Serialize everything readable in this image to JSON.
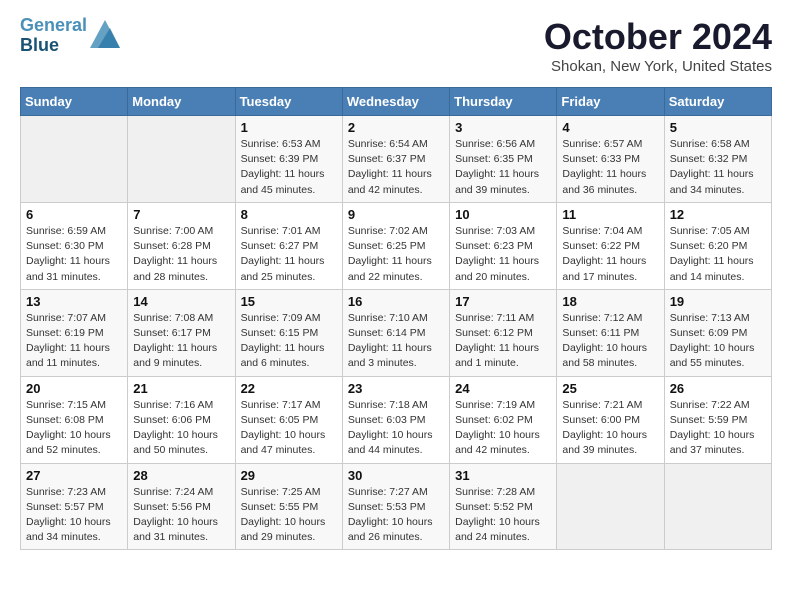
{
  "header": {
    "logo_line1": "General",
    "logo_line2": "Blue",
    "month": "October 2024",
    "location": "Shokan, New York, United States"
  },
  "weekdays": [
    "Sunday",
    "Monday",
    "Tuesday",
    "Wednesday",
    "Thursday",
    "Friday",
    "Saturday"
  ],
  "weeks": [
    [
      {
        "day": "",
        "detail": ""
      },
      {
        "day": "",
        "detail": ""
      },
      {
        "day": "1",
        "detail": "Sunrise: 6:53 AM\nSunset: 6:39 PM\nDaylight: 11 hours\nand 45 minutes."
      },
      {
        "day": "2",
        "detail": "Sunrise: 6:54 AM\nSunset: 6:37 PM\nDaylight: 11 hours\nand 42 minutes."
      },
      {
        "day": "3",
        "detail": "Sunrise: 6:56 AM\nSunset: 6:35 PM\nDaylight: 11 hours\nand 39 minutes."
      },
      {
        "day": "4",
        "detail": "Sunrise: 6:57 AM\nSunset: 6:33 PM\nDaylight: 11 hours\nand 36 minutes."
      },
      {
        "day": "5",
        "detail": "Sunrise: 6:58 AM\nSunset: 6:32 PM\nDaylight: 11 hours\nand 34 minutes."
      }
    ],
    [
      {
        "day": "6",
        "detail": "Sunrise: 6:59 AM\nSunset: 6:30 PM\nDaylight: 11 hours\nand 31 minutes."
      },
      {
        "day": "7",
        "detail": "Sunrise: 7:00 AM\nSunset: 6:28 PM\nDaylight: 11 hours\nand 28 minutes."
      },
      {
        "day": "8",
        "detail": "Sunrise: 7:01 AM\nSunset: 6:27 PM\nDaylight: 11 hours\nand 25 minutes."
      },
      {
        "day": "9",
        "detail": "Sunrise: 7:02 AM\nSunset: 6:25 PM\nDaylight: 11 hours\nand 22 minutes."
      },
      {
        "day": "10",
        "detail": "Sunrise: 7:03 AM\nSunset: 6:23 PM\nDaylight: 11 hours\nand 20 minutes."
      },
      {
        "day": "11",
        "detail": "Sunrise: 7:04 AM\nSunset: 6:22 PM\nDaylight: 11 hours\nand 17 minutes."
      },
      {
        "day": "12",
        "detail": "Sunrise: 7:05 AM\nSunset: 6:20 PM\nDaylight: 11 hours\nand 14 minutes."
      }
    ],
    [
      {
        "day": "13",
        "detail": "Sunrise: 7:07 AM\nSunset: 6:19 PM\nDaylight: 11 hours\nand 11 minutes."
      },
      {
        "day": "14",
        "detail": "Sunrise: 7:08 AM\nSunset: 6:17 PM\nDaylight: 11 hours\nand 9 minutes."
      },
      {
        "day": "15",
        "detail": "Sunrise: 7:09 AM\nSunset: 6:15 PM\nDaylight: 11 hours\nand 6 minutes."
      },
      {
        "day": "16",
        "detail": "Sunrise: 7:10 AM\nSunset: 6:14 PM\nDaylight: 11 hours\nand 3 minutes."
      },
      {
        "day": "17",
        "detail": "Sunrise: 7:11 AM\nSunset: 6:12 PM\nDaylight: 11 hours\nand 1 minute."
      },
      {
        "day": "18",
        "detail": "Sunrise: 7:12 AM\nSunset: 6:11 PM\nDaylight: 10 hours\nand 58 minutes."
      },
      {
        "day": "19",
        "detail": "Sunrise: 7:13 AM\nSunset: 6:09 PM\nDaylight: 10 hours\nand 55 minutes."
      }
    ],
    [
      {
        "day": "20",
        "detail": "Sunrise: 7:15 AM\nSunset: 6:08 PM\nDaylight: 10 hours\nand 52 minutes."
      },
      {
        "day": "21",
        "detail": "Sunrise: 7:16 AM\nSunset: 6:06 PM\nDaylight: 10 hours\nand 50 minutes."
      },
      {
        "day": "22",
        "detail": "Sunrise: 7:17 AM\nSunset: 6:05 PM\nDaylight: 10 hours\nand 47 minutes."
      },
      {
        "day": "23",
        "detail": "Sunrise: 7:18 AM\nSunset: 6:03 PM\nDaylight: 10 hours\nand 44 minutes."
      },
      {
        "day": "24",
        "detail": "Sunrise: 7:19 AM\nSunset: 6:02 PM\nDaylight: 10 hours\nand 42 minutes."
      },
      {
        "day": "25",
        "detail": "Sunrise: 7:21 AM\nSunset: 6:00 PM\nDaylight: 10 hours\nand 39 minutes."
      },
      {
        "day": "26",
        "detail": "Sunrise: 7:22 AM\nSunset: 5:59 PM\nDaylight: 10 hours\nand 37 minutes."
      }
    ],
    [
      {
        "day": "27",
        "detail": "Sunrise: 7:23 AM\nSunset: 5:57 PM\nDaylight: 10 hours\nand 34 minutes."
      },
      {
        "day": "28",
        "detail": "Sunrise: 7:24 AM\nSunset: 5:56 PM\nDaylight: 10 hours\nand 31 minutes."
      },
      {
        "day": "29",
        "detail": "Sunrise: 7:25 AM\nSunset: 5:55 PM\nDaylight: 10 hours\nand 29 minutes."
      },
      {
        "day": "30",
        "detail": "Sunrise: 7:27 AM\nSunset: 5:53 PM\nDaylight: 10 hours\nand 26 minutes."
      },
      {
        "day": "31",
        "detail": "Sunrise: 7:28 AM\nSunset: 5:52 PM\nDaylight: 10 hours\nand 24 minutes."
      },
      {
        "day": "",
        "detail": ""
      },
      {
        "day": "",
        "detail": ""
      }
    ]
  ]
}
